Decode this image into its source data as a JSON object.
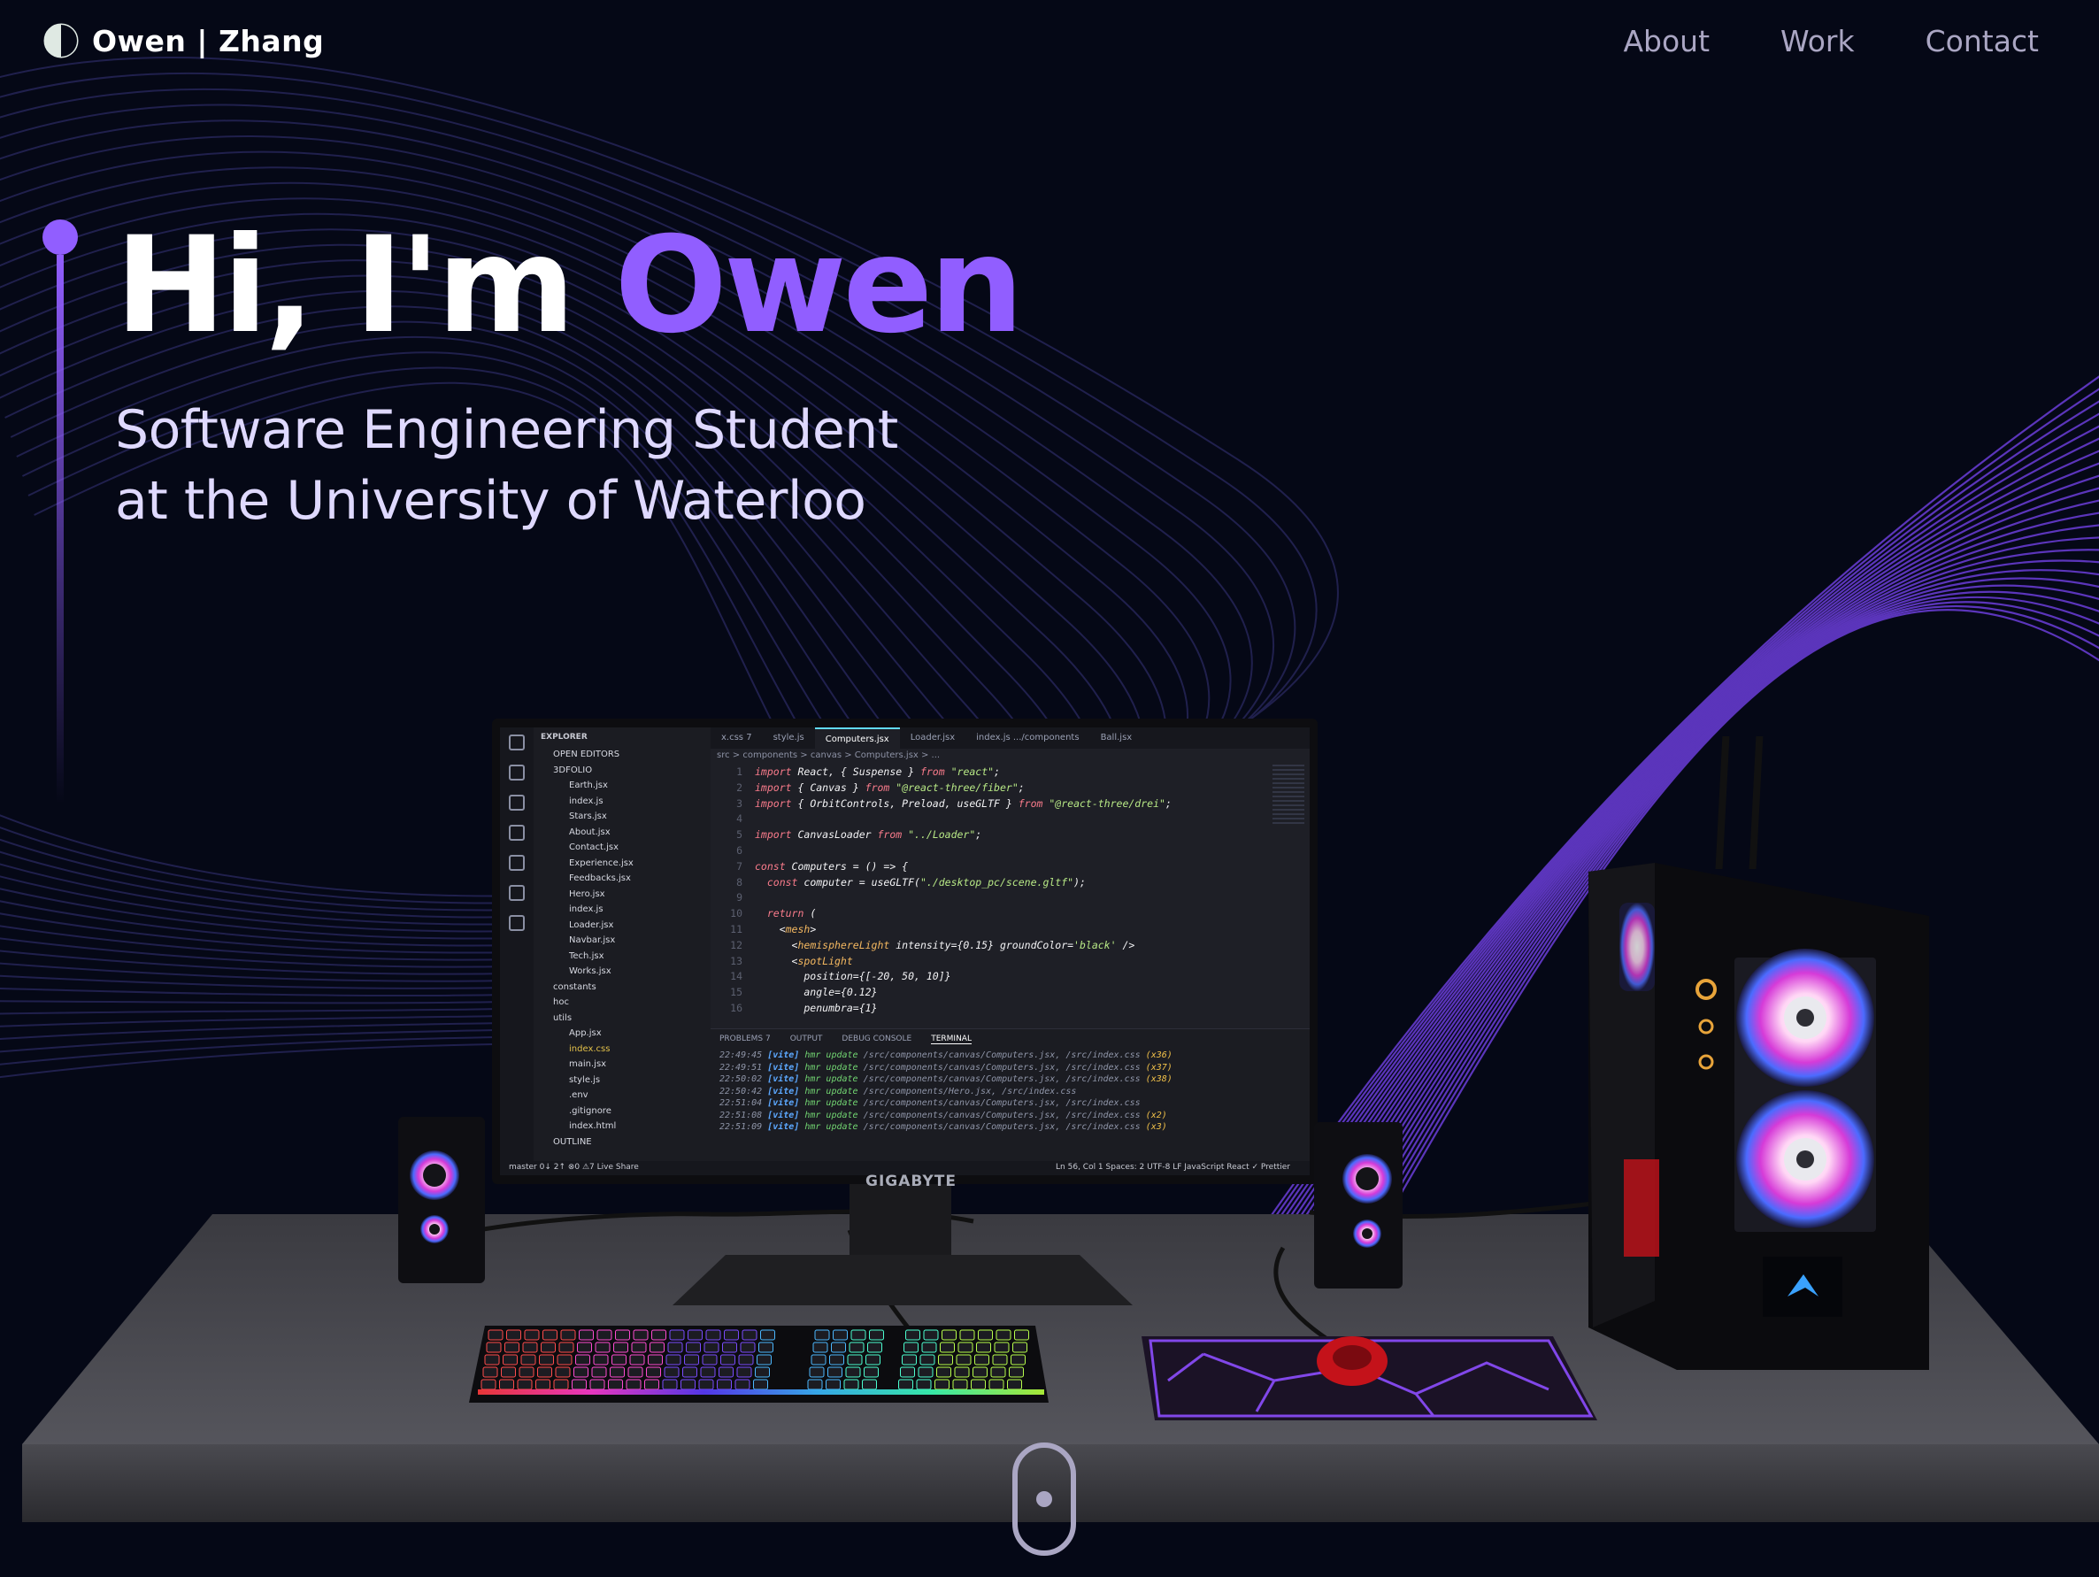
{
  "navbar": {
    "brand_first": "Owen",
    "brand_separator": "|",
    "brand_last": "Zhang",
    "links": [
      "About",
      "Work",
      "Contact"
    ]
  },
  "hero": {
    "greeting": "Hi, I'm ",
    "name": "Owen",
    "subtitle_line1": "Software Engineering Student",
    "subtitle_line2": "at the University of Waterloo"
  },
  "monitor": {
    "brand": "GIGABYTE",
    "editor": {
      "explorer_header": "EXPLORER",
      "explorer_rows": [
        {
          "label": "OPEN EDITORS",
          "type": "folder"
        },
        {
          "label": "3DFOLIO",
          "type": "folder"
        },
        {
          "label": "Earth.jsx",
          "type": "file"
        },
        {
          "label": "index.js",
          "type": "file"
        },
        {
          "label": "Stars.jsx",
          "type": "file"
        },
        {
          "label": "About.jsx",
          "type": "file"
        },
        {
          "label": "Contact.jsx",
          "type": "file"
        },
        {
          "label": "Experience.jsx",
          "type": "file"
        },
        {
          "label": "Feedbacks.jsx",
          "type": "file"
        },
        {
          "label": "Hero.jsx",
          "type": "file"
        },
        {
          "label": "index.js",
          "type": "file"
        },
        {
          "label": "Loader.jsx",
          "type": "file"
        },
        {
          "label": "Navbar.jsx",
          "type": "file"
        },
        {
          "label": "Tech.jsx",
          "type": "file"
        },
        {
          "label": "Works.jsx",
          "type": "file"
        },
        {
          "label": "constants",
          "type": "folder"
        },
        {
          "label": "hoc",
          "type": "folder"
        },
        {
          "label": "utils",
          "type": "folder"
        },
        {
          "label": "App.jsx",
          "type": "file"
        },
        {
          "label": "index.css",
          "type": "file-modified"
        },
        {
          "label": "main.jsx",
          "type": "file"
        },
        {
          "label": "style.js",
          "type": "file"
        },
        {
          "label": ".env",
          "type": "file"
        },
        {
          "label": ".gitignore",
          "type": "file"
        },
        {
          "label": "index.html",
          "type": "file"
        },
        {
          "label": "OUTLINE",
          "type": "folder"
        }
      ],
      "tabs": [
        "x.css 7",
        "style.js",
        "Computers.jsx",
        "Loader.jsx",
        "index.js .../components",
        "Ball.jsx"
      ],
      "active_tab": "Computers.jsx",
      "breadcrumb": "src > components > canvas > Computers.jsx > ...",
      "code_lines": [
        {
          "n": "1",
          "code": "import React, { Suspense } from \"react\";"
        },
        {
          "n": "2",
          "code": "import { Canvas } from \"@react-three/fiber\";"
        },
        {
          "n": "3",
          "code": "import { OrbitControls, Preload, useGLTF } from \"@react-three/drei\";"
        },
        {
          "n": "4",
          "code": ""
        },
        {
          "n": "5",
          "code": "import CanvasLoader from \"../Loader\";"
        },
        {
          "n": "6",
          "code": ""
        },
        {
          "n": "7",
          "code": "const Computers = () => {"
        },
        {
          "n": "8",
          "code": "  const computer = useGLTF(\"./desktop_pc/scene.gltf\");"
        },
        {
          "n": "9",
          "code": ""
        },
        {
          "n": "10",
          "code": "  return ("
        },
        {
          "n": "11",
          "code": "    <mesh>"
        },
        {
          "n": "12",
          "code": "      <hemisphereLight intensity={0.15} groundColor='black' />"
        },
        {
          "n": "13",
          "code": "      <spotLight"
        },
        {
          "n": "14",
          "code": "        position={[-20, 50, 10]}"
        },
        {
          "n": "15",
          "code": "        angle={0.12}"
        },
        {
          "n": "16",
          "code": "        penumbra={1}"
        }
      ],
      "panel_tabs": [
        "PROBLEMS 7",
        "OUTPUT",
        "DEBUG CONSOLE",
        "TERMINAL"
      ],
      "terminal_lines": [
        {
          "time": "22:49:45",
          "msg": "hmr update /src/components/canvas/Computers.jsx, /src/index.css",
          "count": "(x36)"
        },
        {
          "time": "22:49:51",
          "msg": "hmr update /src/components/canvas/Computers.jsx, /src/index.css",
          "count": "(x37)"
        },
        {
          "time": "22:50:02",
          "msg": "hmr update /src/components/canvas/Computers.jsx, /src/index.css",
          "count": "(x38)"
        },
        {
          "time": "22:50:42",
          "msg": "hmr update /src/components/Hero.jsx, /src/index.css",
          "count": ""
        },
        {
          "time": "22:51:04",
          "msg": "hmr update /src/components/canvas/Computers.jsx, /src/index.css",
          "count": ""
        },
        {
          "time": "22:51:08",
          "msg": "hmr update /src/components/canvas/Computers.jsx, /src/index.css",
          "count": "(x2)"
        },
        {
          "time": "22:51:09",
          "msg": "hmr update /src/components/canvas/Computers.jsx, /src/index.css",
          "count": "(x3)"
        }
      ],
      "status_left": "master  0↓ 2↑  ⊗0 ⚠7  Live Share",
      "status_right": "Ln 56, Col 1   Spaces: 2   UTF-8   LF   JavaScript React   ✓ Prettier"
    }
  },
  "colors": {
    "background": "#050816",
    "accent": "#915eff",
    "nav_link": "#aaa6c3",
    "subtitle": "#dfd9ff"
  },
  "icons": {
    "brand_logo": "half-moon-circle-icon",
    "scroll_indicator": "mouse-scroll-icon"
  }
}
